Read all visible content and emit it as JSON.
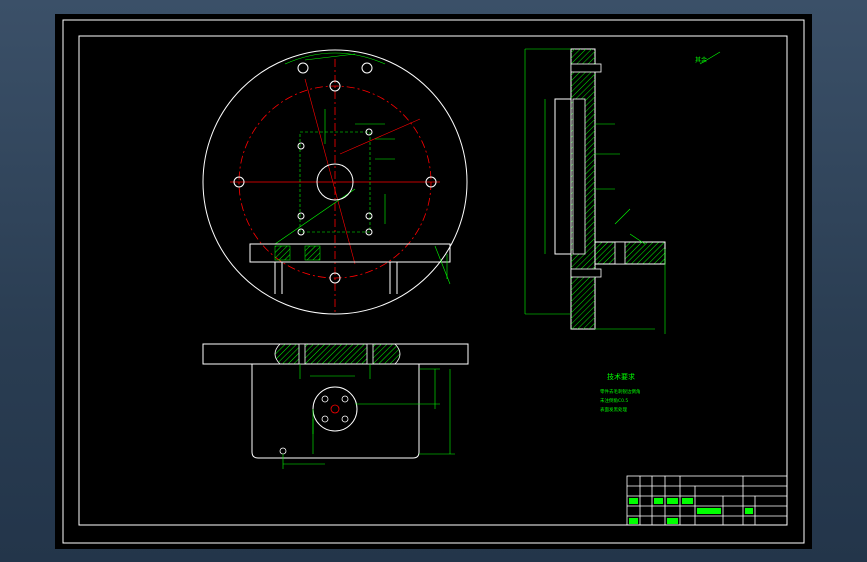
{
  "colors": {
    "background": "#2c3f55",
    "paper": "#000000",
    "outline": "#ffffff",
    "dimension": "#00ff00",
    "centerline": "#ff0000",
    "hatch": "#00ff00"
  },
  "drawing": {
    "roughness_note": "其余",
    "tech_req_title": "技术要求",
    "tech_req_lines": [
      "零件去毛刺锐边倒角",
      "未注倒角C0.5",
      "表面发黑处理"
    ]
  },
  "title_block": {
    "rows": 5
  }
}
